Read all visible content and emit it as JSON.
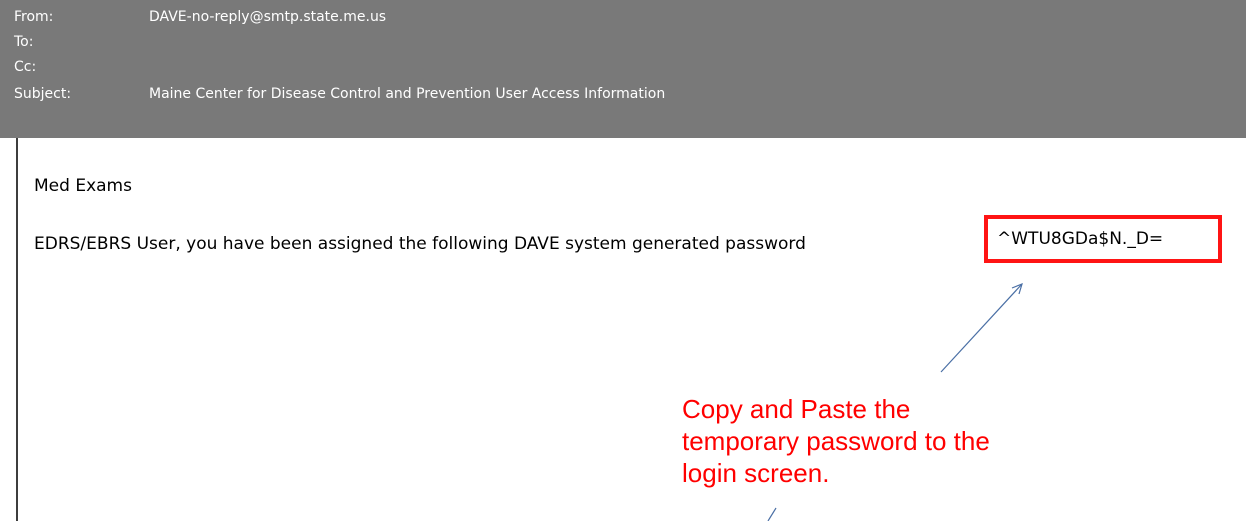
{
  "header": {
    "from_label": "From:",
    "from_value": "DAVE-no-reply@smtp.state.me.us",
    "to_label": "To:",
    "to_value": "",
    "cc_label": "Cc:",
    "cc_value": "",
    "subject_label": "Subject:",
    "subject_value": "Maine Center for Disease Control and Prevention User Access Information"
  },
  "body": {
    "greeting": "Med Exams",
    "message": "EDRS/EBRS User, you have been assigned the following DAVE system generated password",
    "password": "^WTU8GDa$N._D="
  },
  "annotation": {
    "lines": [
      "Copy and Paste the",
      "temporary password to the",
      "login screen."
    ],
    "color": "#ff0000",
    "box_color": "#ff1414",
    "arrow_color": "#4a6fa5"
  },
  "colors": {
    "header_bg": "#797979",
    "header_text": "#ffffff"
  }
}
